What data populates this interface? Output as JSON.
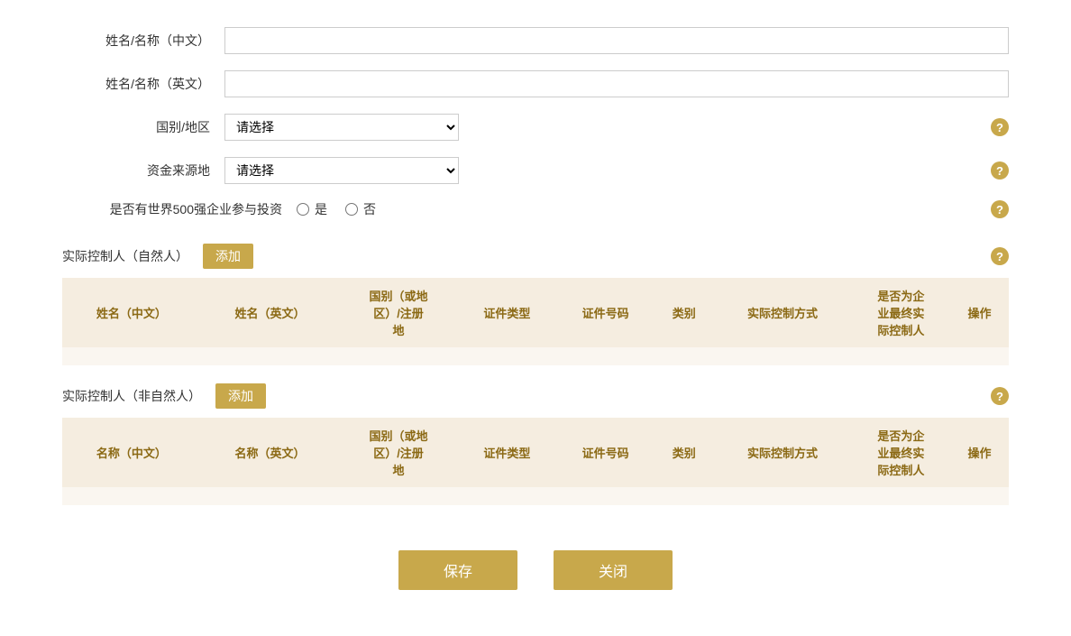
{
  "form": {
    "name_cn_label": "姓名/名称（中文）",
    "name_en_label": "姓名/名称（英文）",
    "country_label": "国别/地区",
    "country_placeholder": "请选择",
    "fund_source_label": "资金来源地",
    "fund_source_placeholder": "请选择",
    "fortune500_label": "是否有世界500强企业参与投资",
    "fortune500_yes": "是",
    "fortune500_no": "否",
    "section1_title": "实际控制人（自然人）",
    "section1_add_btn": "添加",
    "section2_title": "实际控制人（非自然人）",
    "section2_add_btn": "添加",
    "table1_headers": [
      "姓名（中文）",
      "姓名（英文）",
      "国别（或地区）/注册地",
      "证件类型",
      "证件号码",
      "类别",
      "实际控制方式",
      "是否为企业最终实际控制人",
      "操作"
    ],
    "table2_headers": [
      "名称（中文）",
      "名称（英文）",
      "国别（或地区）/注册地",
      "证件类型",
      "证件号码",
      "类别",
      "实际控制方式",
      "是否为企业最终实际控制人",
      "操作"
    ],
    "save_btn": "保存",
    "close_btn": "关闭",
    "help_icon_label": "?"
  }
}
